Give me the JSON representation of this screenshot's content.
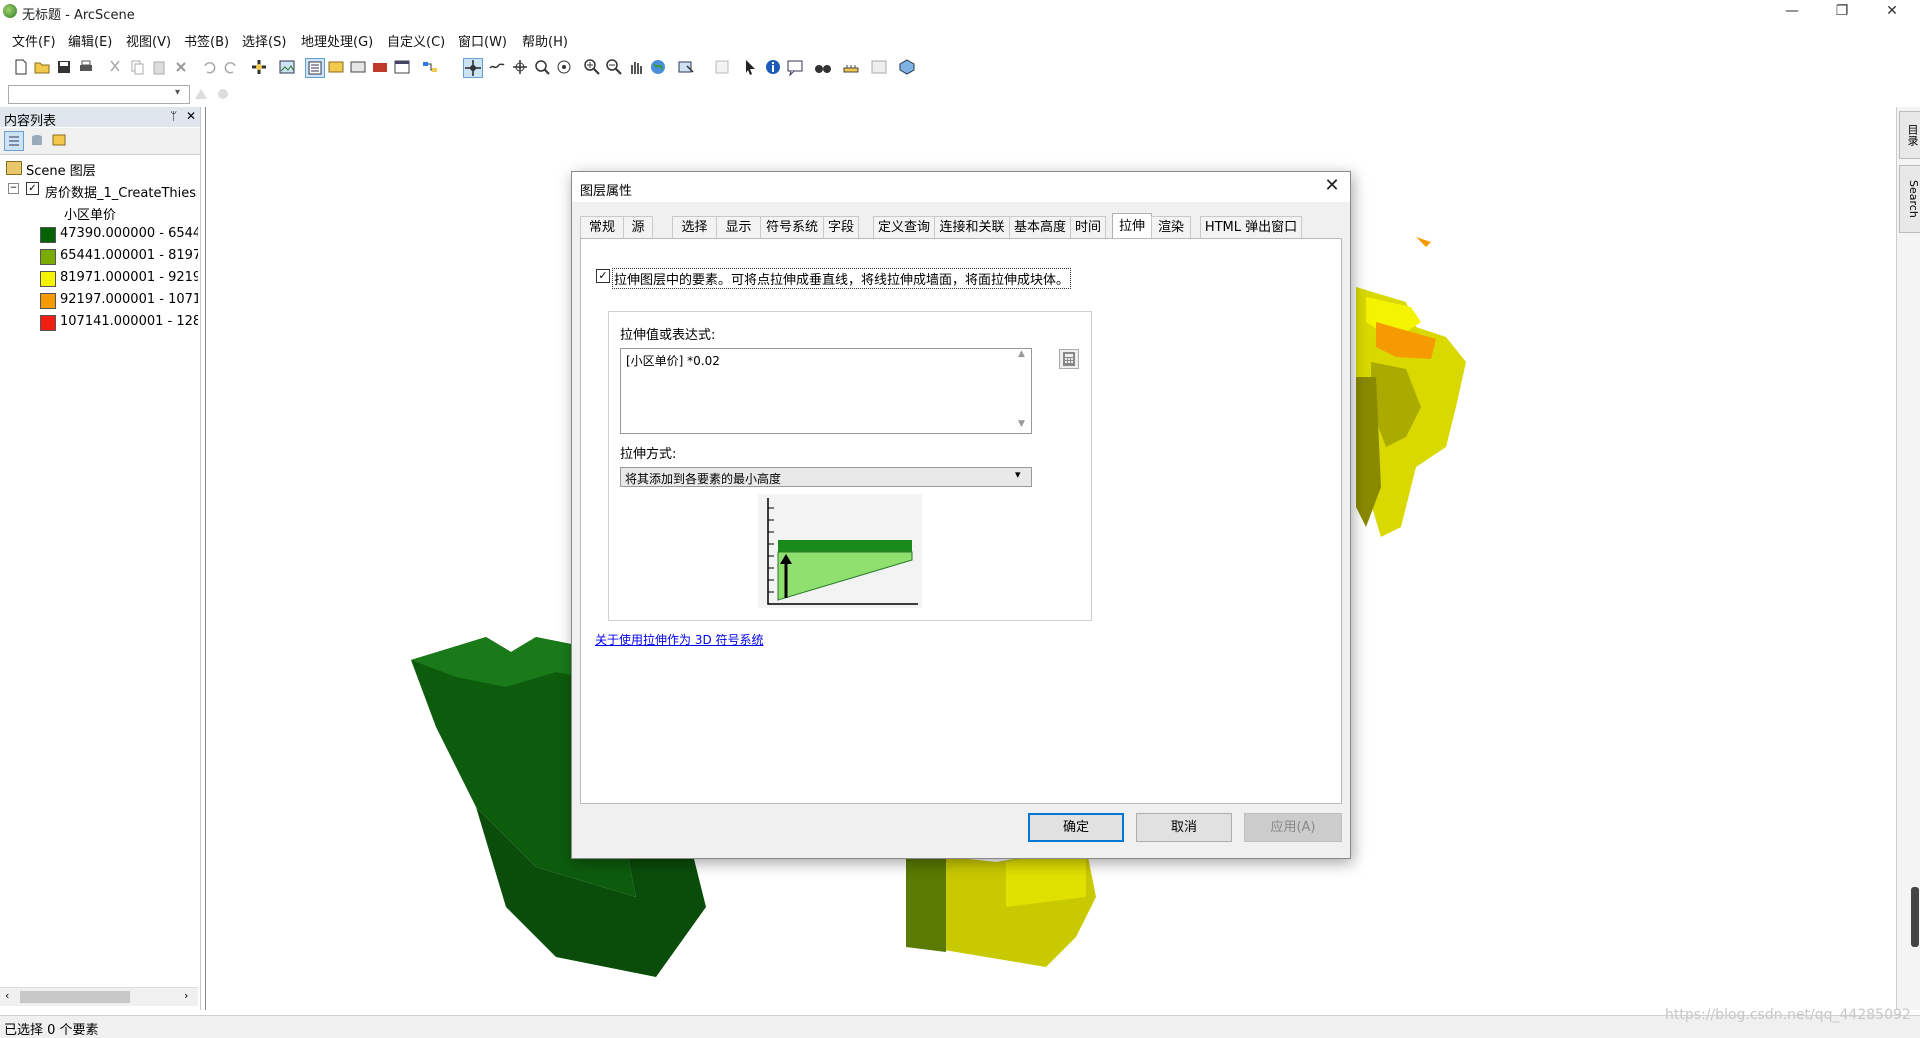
{
  "window": {
    "title": "无标题 - ArcScene",
    "minimize": "—",
    "restore": "❐",
    "close": "✕"
  },
  "menu": [
    "文件(F)",
    "编辑(E)",
    "视图(V)",
    "书签(B)",
    "选择(S)",
    "地理处理(G)",
    "自定义(C)",
    "窗口(W)",
    "帮助(H)"
  ],
  "toc": {
    "title": "内容列表",
    "pin": "ᛘ",
    "close": "✕",
    "root": "Scene 图层",
    "layer": "房价数据_1_CreateThiess",
    "field": "小区单价",
    "classes": [
      {
        "label": "47390.000000 - 6544",
        "color": "#006400"
      },
      {
        "label": "65441.000001 - 8197",
        "color": "#7aab00"
      },
      {
        "label": "81971.000001 - 9219",
        "color": "#f4f400"
      },
      {
        "label": "92197.000001 - 1071",
        "color": "#f59a00"
      },
      {
        "label": "107141.000001 - 128",
        "color": "#f01f12"
      }
    ]
  },
  "right_dock": {
    "tab1": "目录",
    "tab2": "Search"
  },
  "status": {
    "selected": "已选择 0 个要素"
  },
  "watermark": "https://blog.csdn.net/qq_44285092",
  "dialog": {
    "title": "图层属性",
    "close": "✕",
    "tabs": [
      "常规",
      "源",
      "选择",
      "显示",
      "符号系统",
      "字段",
      "定义查询",
      "连接和关联",
      "基本高度",
      "时间",
      "拉伸",
      "渲染",
      "HTML 弹出窗口"
    ],
    "active_tab": "拉伸",
    "extrude_checkbox_checked": true,
    "extrude_description": "拉伸图层中的要素。可将点拉伸成垂直线，将线拉伸成墙面，将面拉伸成块体。",
    "expression_label": "拉伸值或表达式:",
    "expression_value": "[小区单价] *0.02",
    "method_label": "拉伸方式:",
    "method_value": "将其添加到各要素的最小高度",
    "help_link": "关于使用拉伸作为 3D 符号系统",
    "buttons": {
      "ok": "确定",
      "cancel": "取消",
      "apply": "应用(A)"
    }
  }
}
